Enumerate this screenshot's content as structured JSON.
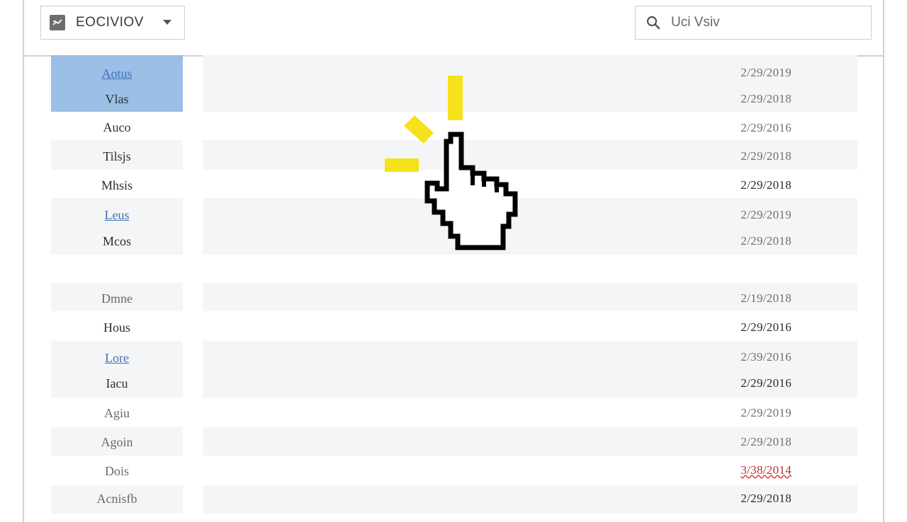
{
  "toolbar": {
    "view_select": {
      "label": "EOCIVIOV",
      "icon": "view-mode-icon"
    },
    "search": {
      "placeholder": "Uci Vsiv",
      "icon": "search-icon"
    }
  },
  "colors": {
    "selected_row": "#9bbfe6",
    "shaded_row": "#f4f5f7",
    "link": "#3b73b9",
    "click_burst": "#f5e219"
  },
  "rows": [
    {
      "name": "Aotus",
      "date": "2/29/2019"
    },
    {
      "name": "Vlas",
      "date": "2/29/2018"
    },
    {
      "name": "Auco",
      "date": "2/29/2016"
    },
    {
      "name": "Tilsjs",
      "date": "2/29/2018"
    },
    {
      "name": "Mhsis",
      "date": "2/29/2018"
    },
    {
      "name": "Leus",
      "date": "2/29/2019"
    },
    {
      "name": "Mcos",
      "date": "2/29/2018"
    },
    {
      "name": "Dmne",
      "date": "2/19/2018"
    },
    {
      "name": "Hous",
      "date": "2/29/2016"
    },
    {
      "name": "Lore",
      "date": "2/39/2016"
    },
    {
      "name": "Iacu",
      "date": "2/29/2016"
    },
    {
      "name": "Agiu",
      "date": "2/29/2019"
    },
    {
      "name": "Agoin",
      "date": "2/29/2018"
    },
    {
      "name": "Dois",
      "date": "3/38/2014"
    },
    {
      "name": "Acnisfb",
      "date": "2/29/2018"
    }
  ],
  "cursor": {
    "icon": "hand-pointer-icon"
  }
}
